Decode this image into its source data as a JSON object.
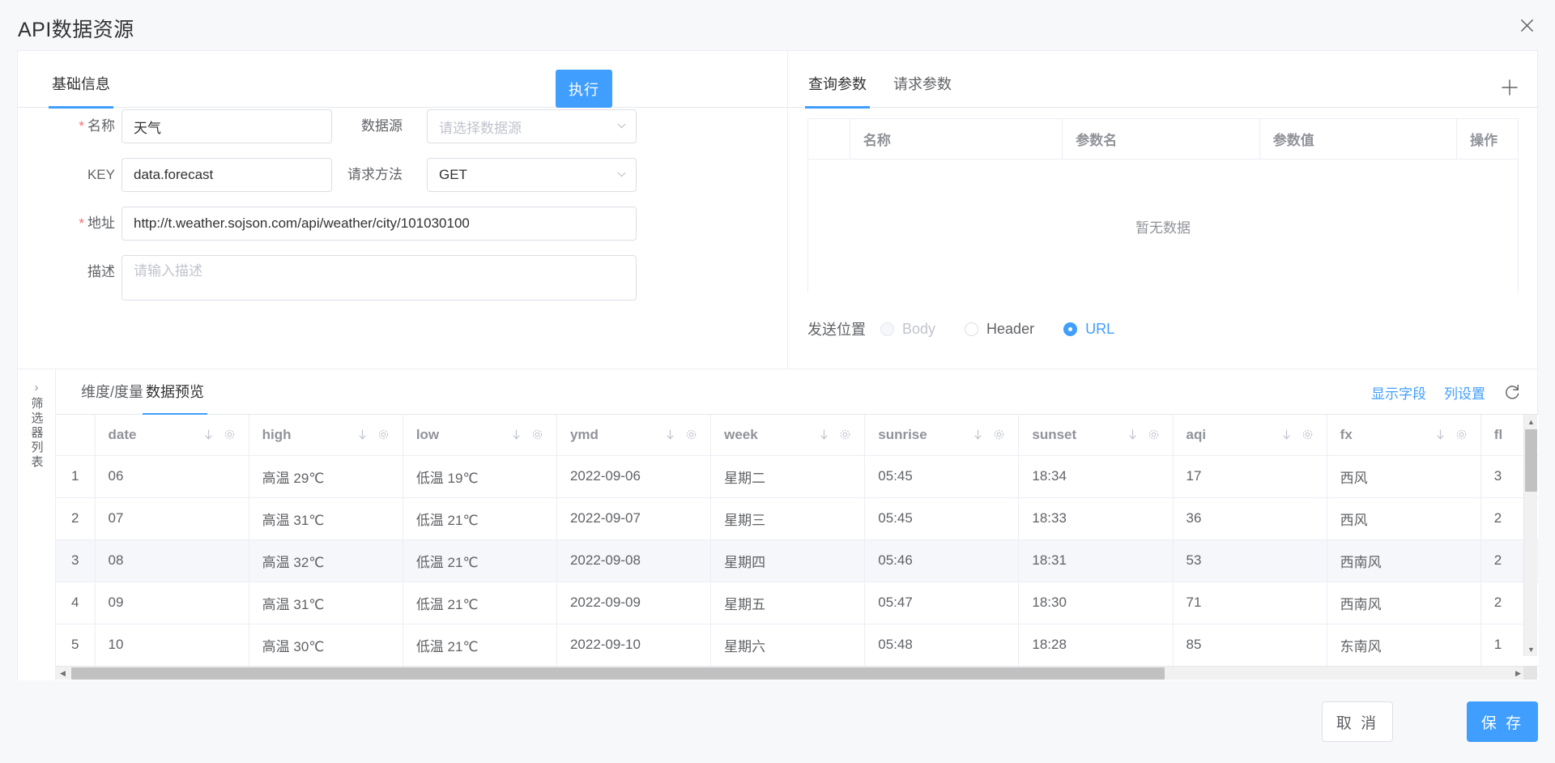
{
  "dialog": {
    "title": "API数据资源",
    "close_icon": "close-icon"
  },
  "basic": {
    "tab_label": "基础信息",
    "execute_label": "执行",
    "fields": {
      "name_label": "名称",
      "name_value": "天气",
      "key_label": "KEY",
      "key_value": "data.forecast",
      "url_label": "地址",
      "url_value": "http://t.weather.sojson.com/api/weather/city/101030100",
      "desc_label": "描述",
      "desc_placeholder": "请输入描述",
      "datasource_label": "数据源",
      "datasource_placeholder": "请选择数据源",
      "method_label": "请求方法",
      "method_value": "GET"
    }
  },
  "params": {
    "tabs": [
      {
        "label": "查询参数",
        "active": true
      },
      {
        "label": "请求参数",
        "active": false
      }
    ],
    "add_icon": "plus-icon",
    "columns": [
      "",
      "名称",
      "参数名",
      "参数值",
      "操作"
    ],
    "empty_text": "暂无数据",
    "rows": [],
    "send_position": {
      "label": "发送位置",
      "options": [
        {
          "label": "Body",
          "checked": false,
          "disabled": true
        },
        {
          "label": "Header",
          "checked": false,
          "disabled": false
        },
        {
          "label": "URL",
          "checked": true,
          "disabled": false
        }
      ]
    }
  },
  "filter_rail": {
    "chevron": "›",
    "text": "筛选器列表"
  },
  "preview": {
    "tabs": [
      {
        "label": "维度/度量",
        "active": false
      },
      {
        "label": "数据预览",
        "active": true
      }
    ],
    "actions": {
      "show_fields": "显示字段",
      "column_settings": "列设置",
      "refresh_icon": "refresh-icon"
    }
  },
  "table": {
    "columns": [
      "date",
      "high",
      "low",
      "ymd",
      "week",
      "sunrise",
      "sunset",
      "aqi",
      "fx",
      "fl"
    ],
    "header_icons": [
      "sort-desc-icon",
      "gear-icon"
    ],
    "rows": [
      {
        "idx": "1",
        "date": "06",
        "high": "高温 29℃",
        "low": "低温 19℃",
        "ymd": "2022-09-06",
        "week": "星期二",
        "sunrise": "05:45",
        "sunset": "18:34",
        "aqi": "17",
        "fx": "西风",
        "fl": "3"
      },
      {
        "idx": "2",
        "date": "07",
        "high": "高温 31℃",
        "low": "低温 21℃",
        "ymd": "2022-09-07",
        "week": "星期三",
        "sunrise": "05:45",
        "sunset": "18:33",
        "aqi": "36",
        "fx": "西风",
        "fl": "2"
      },
      {
        "idx": "3",
        "date": "08",
        "high": "高温 32℃",
        "low": "低温 21℃",
        "ymd": "2022-09-08",
        "week": "星期四",
        "sunrise": "05:46",
        "sunset": "18:31",
        "aqi": "53",
        "fx": "西南风",
        "fl": "2"
      },
      {
        "idx": "4",
        "date": "09",
        "high": "高温 31℃",
        "low": "低温 21℃",
        "ymd": "2022-09-09",
        "week": "星期五",
        "sunrise": "05:47",
        "sunset": "18:30",
        "aqi": "71",
        "fx": "西南风",
        "fl": "2"
      },
      {
        "idx": "5",
        "date": "10",
        "high": "高温 30℃",
        "low": "低温 21℃",
        "ymd": "2022-09-10",
        "week": "星期六",
        "sunrise": "05:48",
        "sunset": "18:28",
        "aqi": "85",
        "fx": "东南风",
        "fl": "1"
      }
    ],
    "highlighted_row_index": 2
  },
  "footer": {
    "cancel_label": "取 消",
    "save_label": "保 存"
  },
  "colors": {
    "accent": "#409eff",
    "page_bg": "#f7f8fa",
    "card_bg": "#ffffff",
    "border": "#ebeef5",
    "required": "#f56c6c",
    "row_alt": "#f5f7fa"
  }
}
